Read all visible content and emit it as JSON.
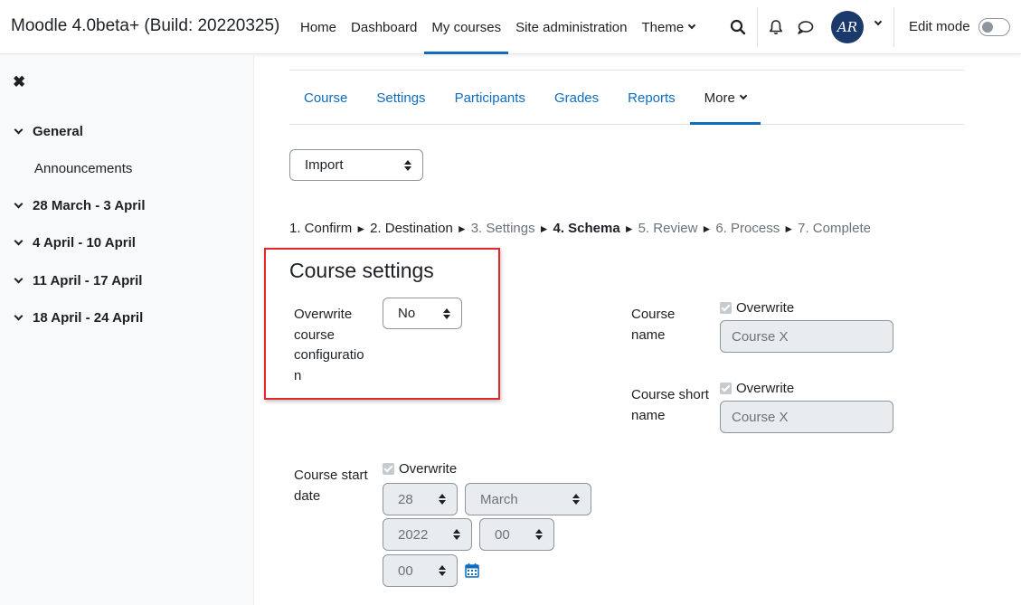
{
  "header": {
    "brand": "Moodle 4.0beta+ (Build: 20220325)",
    "nav": [
      {
        "label": "Home"
      },
      {
        "label": "Dashboard"
      },
      {
        "label": "My courses",
        "active": true
      },
      {
        "label": "Site administration"
      },
      {
        "label": "Theme"
      }
    ],
    "avatar_initials": "AR",
    "edit_mode_label": "Edit mode",
    "edit_mode_on": false
  },
  "drawer": {
    "items": [
      {
        "label": "General",
        "type": "section"
      },
      {
        "label": "Announcements",
        "type": "sub"
      },
      {
        "label": "28 March - 3 April",
        "type": "section"
      },
      {
        "label": "4 April - 10 April",
        "type": "section"
      },
      {
        "label": "11 April - 17 April",
        "type": "section"
      },
      {
        "label": "18 April - 24 April",
        "type": "section"
      }
    ]
  },
  "secondary_nav": {
    "tabs": [
      "Course",
      "Settings",
      "Participants",
      "Grades",
      "Reports",
      "More"
    ],
    "active": "More"
  },
  "action_select": {
    "value": "Import"
  },
  "steps": [
    {
      "label": "1. Confirm",
      "state": "done"
    },
    {
      "label": "2. Destination",
      "state": "done"
    },
    {
      "label": "3. Settings",
      "state": "muted"
    },
    {
      "label": "4. Schema",
      "state": "current"
    },
    {
      "label": "5. Review",
      "state": "muted"
    },
    {
      "label": "6. Process",
      "state": "muted"
    },
    {
      "label": "7. Complete",
      "state": "muted"
    }
  ],
  "form": {
    "heading": "Course settings",
    "overwrite_config": {
      "label_lines": [
        "Overwrite",
        "course",
        "configuratio",
        "n"
      ],
      "value": "No"
    },
    "course_name": {
      "label_lines": [
        "Course",
        "name"
      ],
      "overwrite_label": "Overwrite",
      "value": "Course X"
    },
    "course_short_name": {
      "label_lines": [
        "Course short",
        "name"
      ],
      "overwrite_label": "Overwrite",
      "value": "Course X"
    },
    "course_start_date": {
      "label_lines": [
        "Course start",
        "date"
      ],
      "overwrite_label": "Overwrite",
      "day": "28",
      "month": "March",
      "year": "2022",
      "hour": "00",
      "minute": "00"
    }
  }
}
